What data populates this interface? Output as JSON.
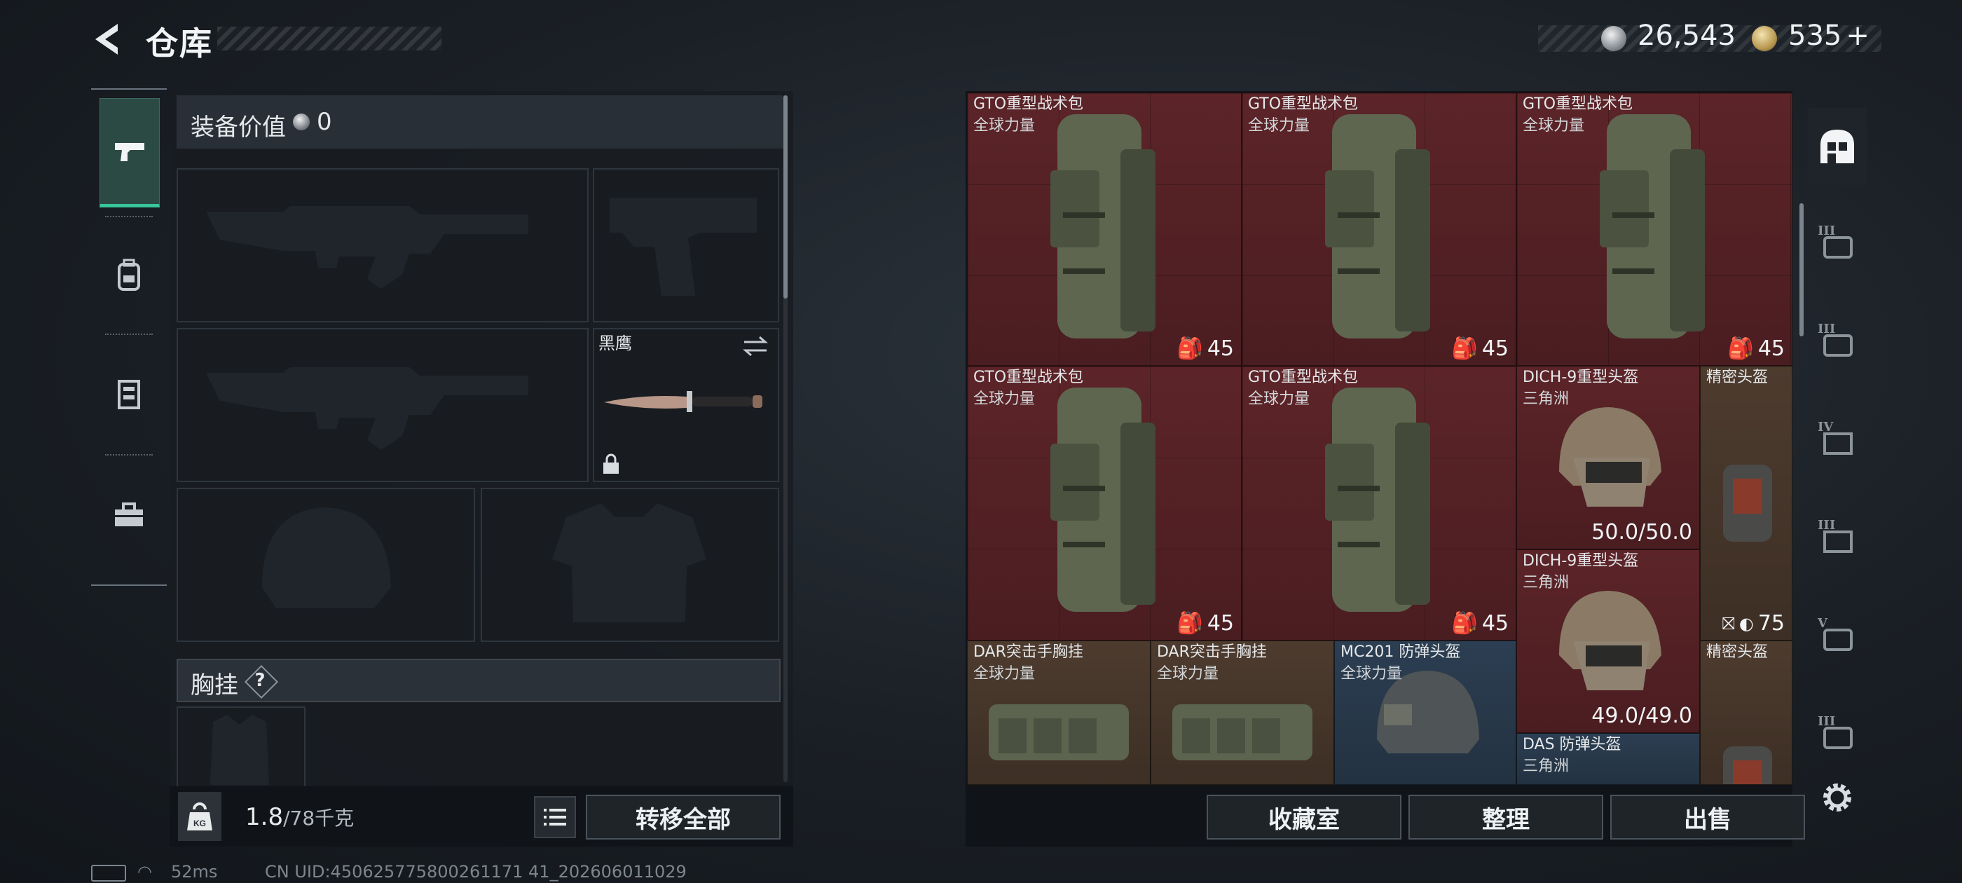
{
  "header": {
    "title": "仓库",
    "currency_silver": "26,543",
    "currency_gold": "535",
    "gold_plus": "+"
  },
  "left_tabs": [
    "pistol-icon",
    "backpack-icon",
    "armor-icon",
    "toolbox-icon"
  ],
  "loadout": {
    "value_label": "装备价值",
    "value": "0",
    "knife_name": "黑鹰",
    "chest_label": "胸挂",
    "chest_help": "?",
    "weight_current": "1.8",
    "weight_max": "/78千克",
    "transfer_all": "转移全部"
  },
  "storage": {
    "items": [
      {
        "name": "GTO重型战术包",
        "sub": "全球力量",
        "badge": "45"
      },
      {
        "name": "GTO重型战术包",
        "sub": "全球力量",
        "badge": "45"
      },
      {
        "name": "GTO重型战术包",
        "sub": "全球力量",
        "badge": "45"
      },
      {
        "name": "GTO重型战术包",
        "sub": "全球力量",
        "badge": "45"
      },
      {
        "name": "GTO重型战术包",
        "sub": "全球力量",
        "badge": "45"
      },
      {
        "name": "DICH-9重型头盔",
        "sub": "三角洲",
        "durability": "50.0/50.0"
      },
      {
        "name": "精密头盔",
        "sub": "",
        "badge": "75"
      },
      {
        "name": "DICH-9重型头盔",
        "sub": "三角洲",
        "durability": "49.0/49.0"
      },
      {
        "name": "DAR突击手胸挂",
        "sub": "全球力量"
      },
      {
        "name": "DAR突击手胸挂",
        "sub": "全球力量"
      },
      {
        "name": "MC201 防弹头盔",
        "sub": "全球力量"
      },
      {
        "name": "精密头盔",
        "sub": ""
      },
      {
        "name": "DAS 防弹头盔",
        "sub": "三角洲"
      }
    ],
    "buttons": {
      "collection": "收藏室",
      "organize": "整理",
      "sell": "出售"
    }
  },
  "right_tabs": [
    "home-grid-icon",
    "tier-3-icon",
    "tier-3b-icon",
    "tier-4-icon",
    "tier-3c-icon",
    "tier-5-icon",
    "tier-3d-icon"
  ],
  "status": {
    "ping": "52ms",
    "uid": "CN UID:450625775800261171 41_202606011029"
  }
}
